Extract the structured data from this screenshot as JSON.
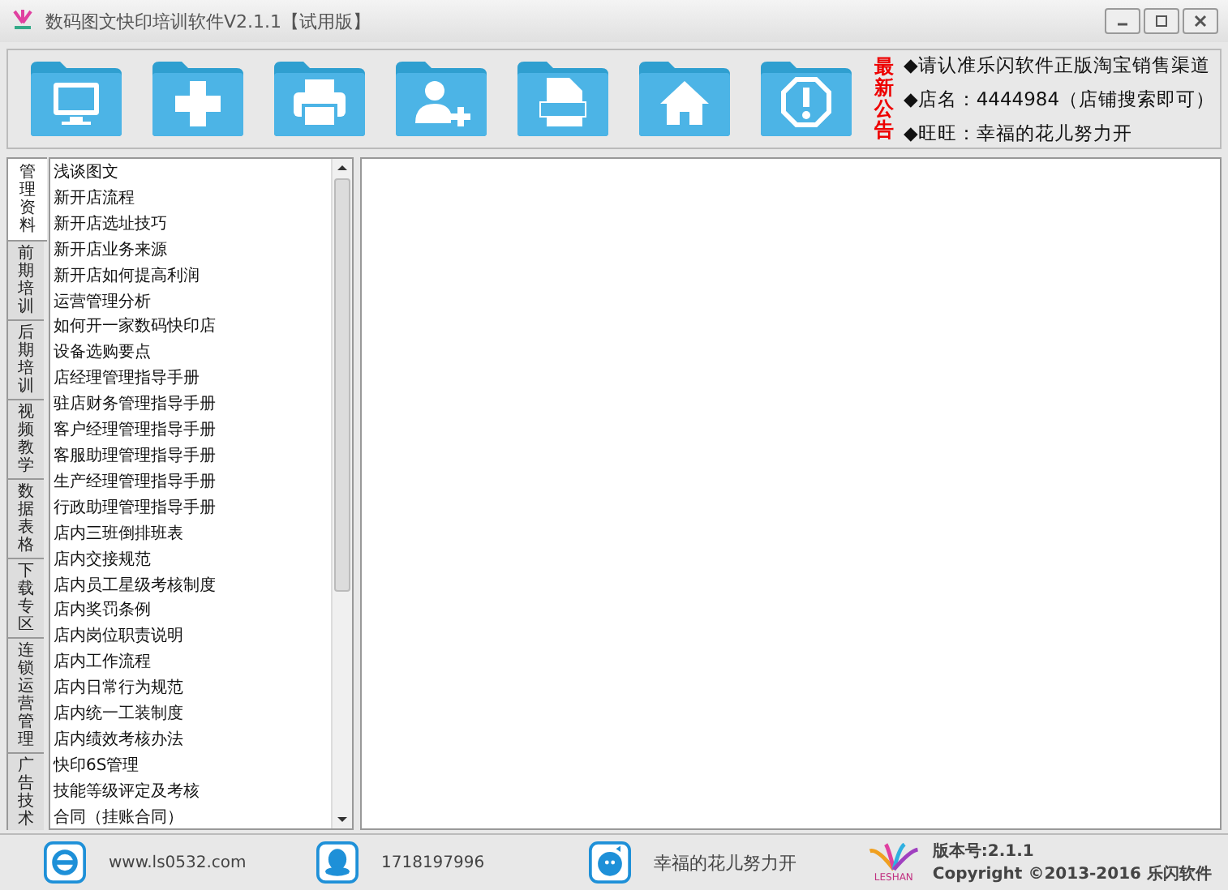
{
  "window": {
    "title": "数码图文快印培训软件V2.1.1【试用版】"
  },
  "toolbar": [
    {
      "kind": "monitor"
    },
    {
      "kind": "plus"
    },
    {
      "kind": "printer"
    },
    {
      "kind": "user-add"
    },
    {
      "kind": "doc"
    },
    {
      "kind": "home"
    },
    {
      "kind": "alert"
    }
  ],
  "notice": {
    "heading": "最新公告",
    "lines": [
      "◆请认准乐闪软件正版淘宝销售渠道",
      "◆店名：4444984（店铺搜索即可）",
      "◆旺旺：幸福的花儿努力开"
    ]
  },
  "tabs": [
    {
      "label": "管理资料",
      "selected": true
    },
    {
      "label": "前期培训",
      "selected": false
    },
    {
      "label": "后期培训",
      "selected": false
    },
    {
      "label": "视频教学",
      "selected": false
    },
    {
      "label": "数据表格",
      "selected": false
    },
    {
      "label": "下载专区",
      "selected": false
    },
    {
      "label": "连锁运营管理",
      "selected": false
    },
    {
      "label": "广告技术",
      "selected": false
    }
  ],
  "list": {
    "items": [
      "浅谈图文",
      "新开店流程",
      "新开店选址技巧",
      "新开店业务来源",
      "新开店如何提高利润",
      "运营管理分析",
      "如何开一家数码快印店",
      "设备选购要点",
      "店经理管理指导手册",
      "驻店财务管理指导手册",
      "客户经理管理指导手册",
      "客服助理管理指导手册",
      "生产经理管理指导手册",
      "行政助理管理指导手册",
      "店内三班倒排班表",
      "店内交接规范",
      "店内员工星级考核制度",
      "店内奖罚条例",
      "店内岗位职责说明",
      "店内工作流程",
      "店内日常行为规范",
      "店内统一工装制度",
      "店内绩效考核办法",
      "快印6S管理",
      "技能等级评定及考核",
      "合同（挂账合同）"
    ]
  },
  "status_bar": {
    "contacts": [
      {
        "kind": "browser",
        "text": "www.ls0532.com"
      },
      {
        "kind": "qq",
        "text": "1718197996"
      },
      {
        "kind": "chat",
        "text": "幸福的花儿努力开"
      }
    ],
    "logo_text": "LESHAN",
    "version": "版本号:2.1.1",
    "copyright": "Copyright ©2013-2016 乐闪软件"
  }
}
